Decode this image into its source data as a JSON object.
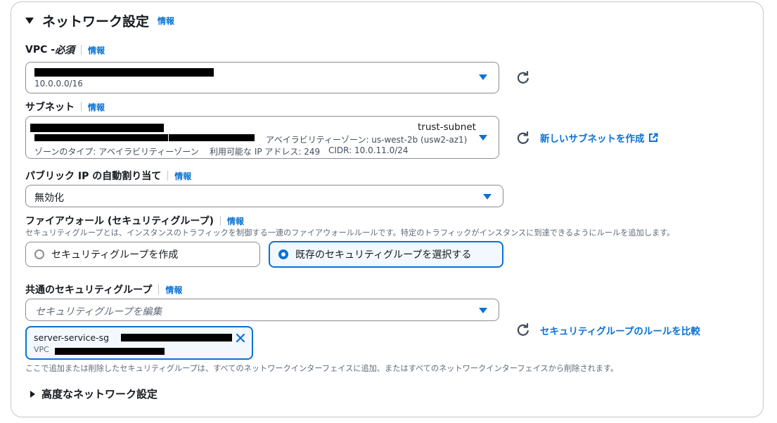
{
  "section": {
    "title": "ネットワーク設定",
    "info": "情報"
  },
  "vpc": {
    "label": "VPC - ",
    "required": "必須",
    "info": "情報",
    "cidr": "10.0.0.0/16"
  },
  "subnet": {
    "label": "サブネット",
    "info": "情報",
    "name": "trust-subnet",
    "az": "アベイラビリティーゾーン: us-west-2b (usw2-az1)",
    "zone_type": "ゾーンのタイプ: アベイラビリティーゾーン",
    "available_ip": "利用可能な IP アドレス: 249",
    "cidr": "CIDR: 10.0.11.0/24",
    "create_link": "新しいサブネットを作成"
  },
  "public_ip": {
    "label": "パブリック IP の自動割り当て",
    "info": "情報",
    "value": "無効化"
  },
  "firewall": {
    "label": "ファイアウォール (セキュリティグループ)",
    "info": "情報",
    "description": "セキュリティグループとは、インスタンスのトラフィックを制御する一連のファイアウォールルールです。特定のトラフィックがインスタンスに到達できるようにルールを追加します。",
    "option_create": "セキュリティグループを作成",
    "option_existing": "既存のセキュリティグループを選択する",
    "selected": "existing"
  },
  "common_sg": {
    "label": "共通のセキュリティグループ",
    "info": "情報",
    "placeholder": "セキュリティグループを編集",
    "token_name": "server-service-sg",
    "token_sub": "VPC",
    "compare_link": "セキュリティグループのルールを比較",
    "footnote": "ここで追加または削除したセキュリティグループは、すべてのネットワークインターフェイスに追加、またはすべてのネットワークインターフェイスから削除されます。"
  },
  "advanced": {
    "title": "高度なネットワーク設定"
  },
  "colors": {
    "link": "#0972d3",
    "selected_bg": "#f2f8fd",
    "border": "#8c8c94"
  }
}
